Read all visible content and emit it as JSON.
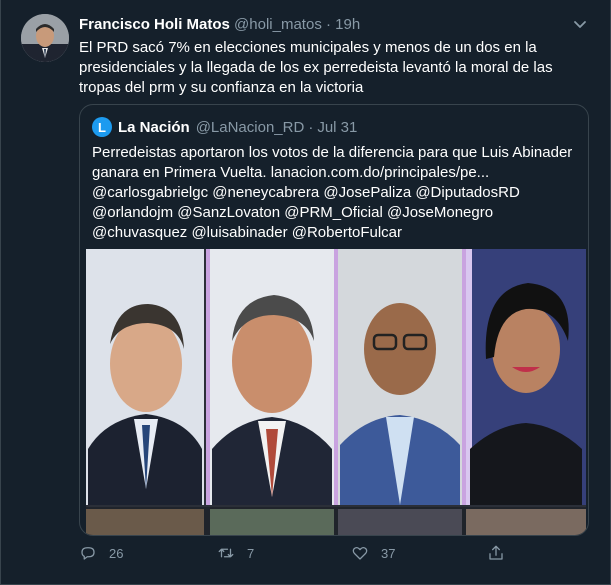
{
  "tweet": {
    "author_name": "Francisco Holi Matos",
    "handle": "@holi_matos",
    "separator": "·",
    "time": "19h",
    "text": "El PRD sacó 7% en elecciones municipales y menos de un dos en la presidenciales y la llegada de los ex perredeista levantó la moral de las tropas del prm y su confianza en la victoria"
  },
  "quote": {
    "logo_letter": "L",
    "author_name": "La Nación",
    "handle": "@LaNacion_RD",
    "separator": "·",
    "date": "Jul 31",
    "text": "Perredeistas aportaron los votos de la diferencia para que Luis Abinader ganara en Primera Vuelta. lanacion.com.do/principales/pe... @carlosgabrielgc @neneycabrera @JosePaliza @DiputadosRD @orlandojm @SanzLovaton @PRM_Oficial @JoseMonegro @chuvasquez @luisabinader @RobertoFulcar"
  },
  "actions": {
    "reply_count": "26",
    "retweet_count": "7",
    "like_count": "37"
  },
  "icons": {
    "reply": "reply-icon",
    "retweet": "retweet-icon",
    "like": "heart-icon",
    "share": "share-icon",
    "more": "chevron-down-icon"
  },
  "colors": {
    "background": "#15202b",
    "border": "#38444d",
    "secondary_text": "#8899a6",
    "accent": "#1d9bf0"
  }
}
